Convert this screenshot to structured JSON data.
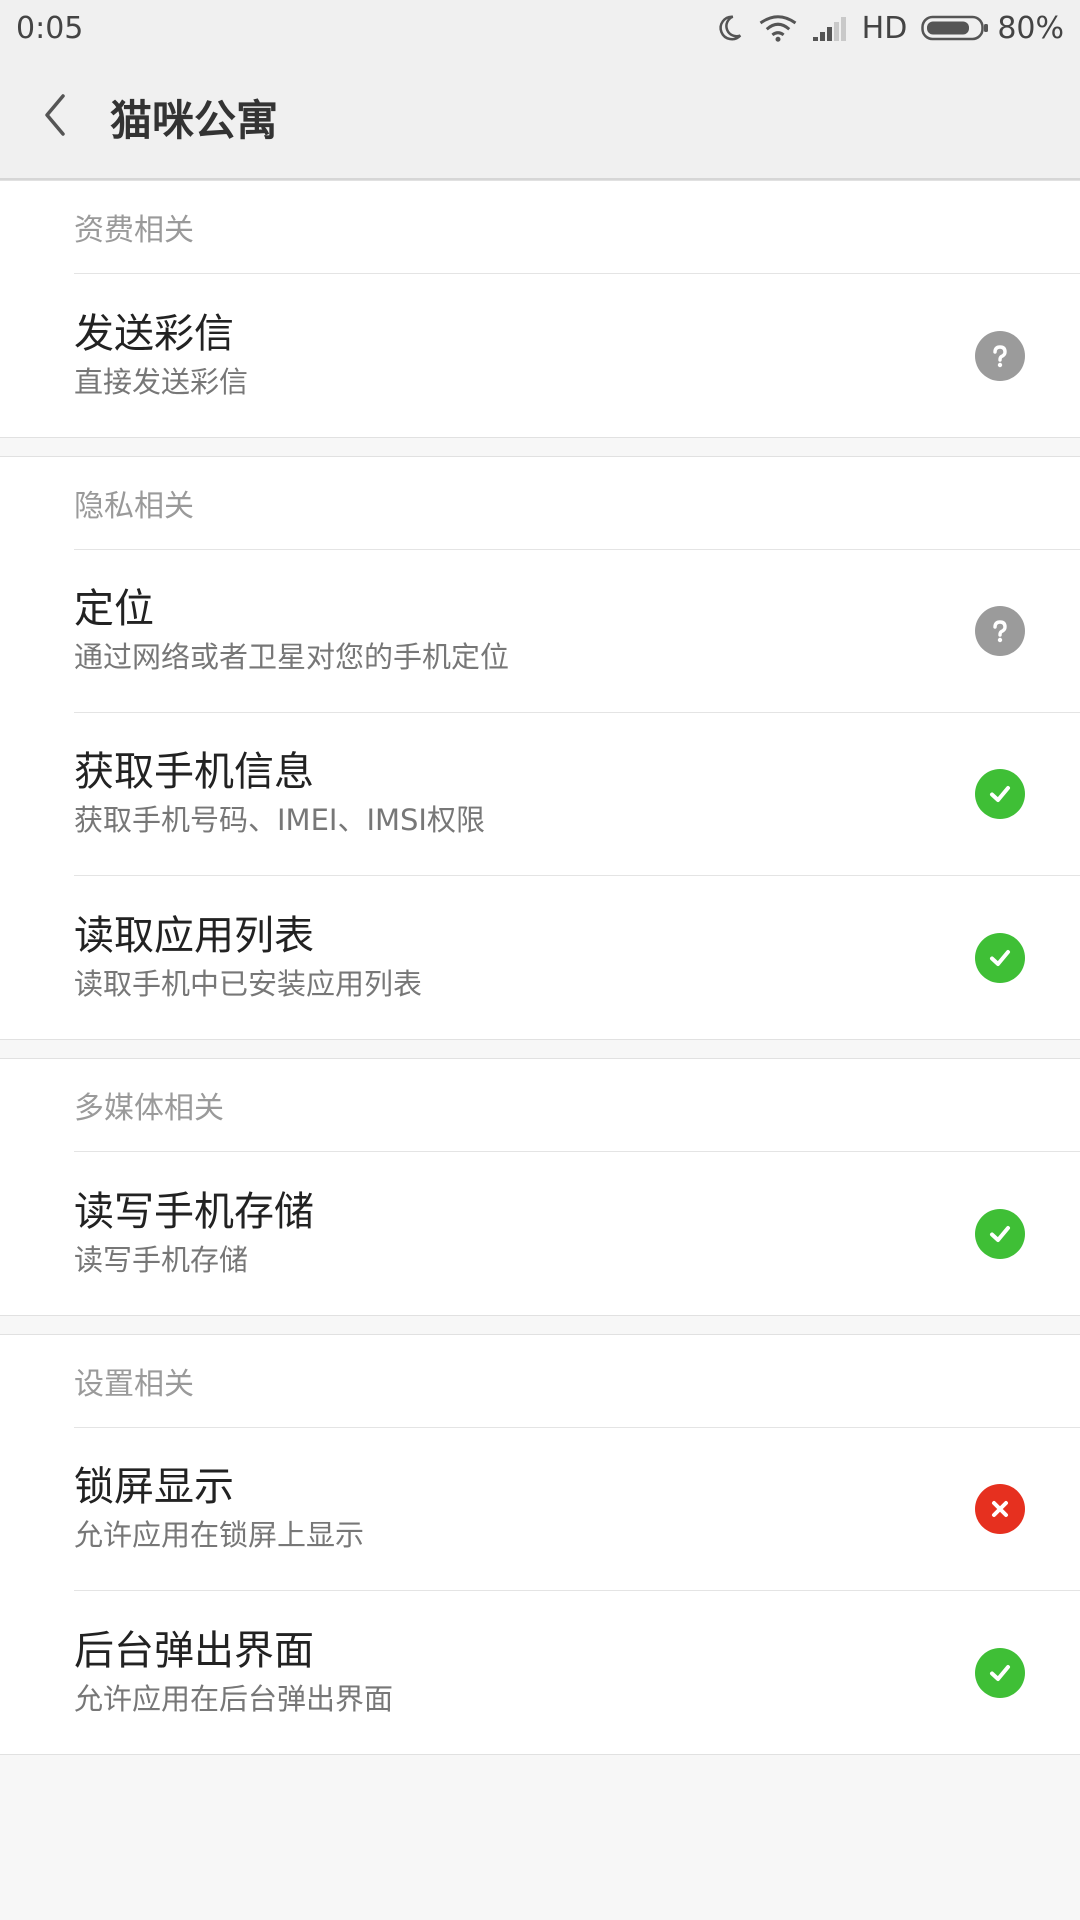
{
  "status_bar": {
    "time": "0:05",
    "network": "HD",
    "battery_level": 0.8,
    "battery_text": "80%"
  },
  "app_bar": {
    "title": "猫咪公寓"
  },
  "colors": {
    "question": "#9b9b9b",
    "allowed": "#3fbf36",
    "denied": "#e6301f"
  },
  "sections": [
    {
      "header": "资费相关",
      "items": [
        {
          "title": "发送彩信",
          "desc": "直接发送彩信",
          "status": "question",
          "icon": "question-icon"
        }
      ]
    },
    {
      "header": "隐私相关",
      "items": [
        {
          "title": "定位",
          "desc": "通过网络或者卫星对您的手机定位",
          "status": "question",
          "icon": "question-icon"
        },
        {
          "title": "获取手机信息",
          "desc": "获取手机号码、IMEI、IMSI权限",
          "status": "allowed",
          "icon": "check-icon"
        },
        {
          "title": "读取应用列表",
          "desc": "读取手机中已安装应用列表",
          "status": "allowed",
          "icon": "check-icon"
        }
      ]
    },
    {
      "header": "多媒体相关",
      "items": [
        {
          "title": "读写手机存储",
          "desc": "读写手机存储",
          "status": "allowed",
          "icon": "check-icon"
        }
      ]
    },
    {
      "header": "设置相关",
      "items": [
        {
          "title": "锁屏显示",
          "desc": "允许应用在锁屏上显示",
          "status": "denied",
          "icon": "cross-icon"
        },
        {
          "title": "后台弹出界面",
          "desc": "允许应用在后台弹出界面",
          "status": "allowed",
          "icon": "check-icon"
        }
      ]
    }
  ]
}
